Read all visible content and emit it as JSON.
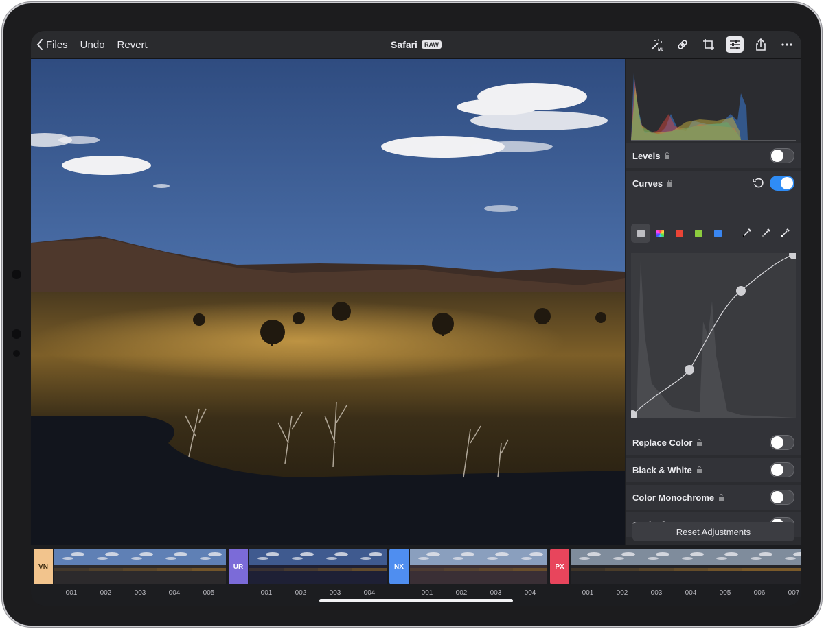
{
  "topbar": {
    "back_label": "Files",
    "undo_label": "Undo",
    "revert_label": "Revert",
    "title": "Safari",
    "badge": "RAW",
    "icons": [
      "ml-magic-wand-icon",
      "bandage-icon",
      "crop-icon",
      "adjustments-icon",
      "share-icon",
      "more-icon"
    ],
    "active_icon": "adjustments-icon"
  },
  "panel": {
    "levels": {
      "label": "Levels",
      "enabled": false
    },
    "curves": {
      "label": "Curves",
      "enabled": true,
      "channels": [
        "gray",
        "rgb",
        "red",
        "green",
        "blue"
      ],
      "selected_channel": "gray"
    },
    "replace_color": {
      "label": "Replace Color",
      "enabled": false
    },
    "black_white": {
      "label": "Black & White",
      "enabled": false
    },
    "color_monochrome": {
      "label": "Color Monochrome",
      "enabled": false
    },
    "sepia": {
      "label": "Sepia",
      "enabled": false
    },
    "reset_label": "Reset Adjustments"
  },
  "filmstrip": {
    "groups": [
      {
        "tag": "VN",
        "color": "#f2c48d",
        "text_color": "#3a2a10",
        "items": [
          "001",
          "002",
          "003",
          "004",
          "005"
        ]
      },
      {
        "tag": "UR",
        "color": "#7b6bd8",
        "text_color": "#ffffff",
        "items": [
          "001",
          "002",
          "003",
          "004"
        ]
      },
      {
        "tag": "NX",
        "color": "#4f8ef0",
        "text_color": "#ffffff",
        "items": [
          "001",
          "002",
          "003",
          "004"
        ]
      },
      {
        "tag": "PX",
        "color": "#e8455c",
        "text_color": "#ffffff",
        "items": [
          "001",
          "002",
          "003",
          "004",
          "005",
          "006",
          "007"
        ]
      }
    ]
  },
  "colors": {
    "accent": "#2f8cf5"
  }
}
